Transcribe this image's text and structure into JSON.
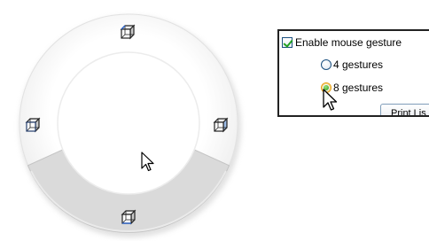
{
  "options": {
    "enable_label": "Enable mouse gesture",
    "gestures_4_label": "4 gestures",
    "gestures_8_label": "8 gestures",
    "print_button_label": "Print Lis",
    "enable_checked": true,
    "selected_gestures": "8 gestures"
  },
  "ring": {
    "active_segment": "bottom",
    "icons": [
      "top-cube-icon",
      "left-cube-icon",
      "right-cube-icon",
      "bottom-cube-icon"
    ]
  },
  "colors": {
    "ring_face": "#fafafa",
    "ring_active_segment": "#dcdcdc",
    "checkbox_border": "#1c5180",
    "radio_selected": "#2c9a16",
    "panel_border": "#222222"
  }
}
